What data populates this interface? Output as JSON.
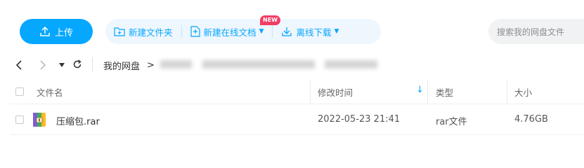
{
  "toolbar": {
    "upload_label": "上传",
    "new_folder_label": "新建文件夹",
    "new_online_doc_label": "新建在线文档",
    "new_badge": "NEW",
    "offline_download_label": "离线下载",
    "search_placeholder": "搜索我的网盘文件"
  },
  "nav": {
    "breadcrumb_root": "我的网盘",
    "separator": ">"
  },
  "table": {
    "columns": [
      "文件名",
      "修改时间",
      "类型",
      "大小"
    ],
    "sort_indicator": "↓",
    "rows": [
      {
        "name": "压缩包.rar",
        "modified": "2022-05-23 21:41",
        "type": "rar文件",
        "size": "4.76GB"
      }
    ]
  },
  "colors": {
    "accent": "#06a7ff",
    "badge": "#f23d64",
    "action_group_bg": "#eef6fe"
  },
  "icons": [
    "upload-icon",
    "new-folder-icon",
    "new-doc-icon",
    "download-icon",
    "back-icon",
    "forward-icon",
    "dropdown-icon",
    "refresh-icon",
    "sort-down-icon",
    "rar-file-icon"
  ]
}
